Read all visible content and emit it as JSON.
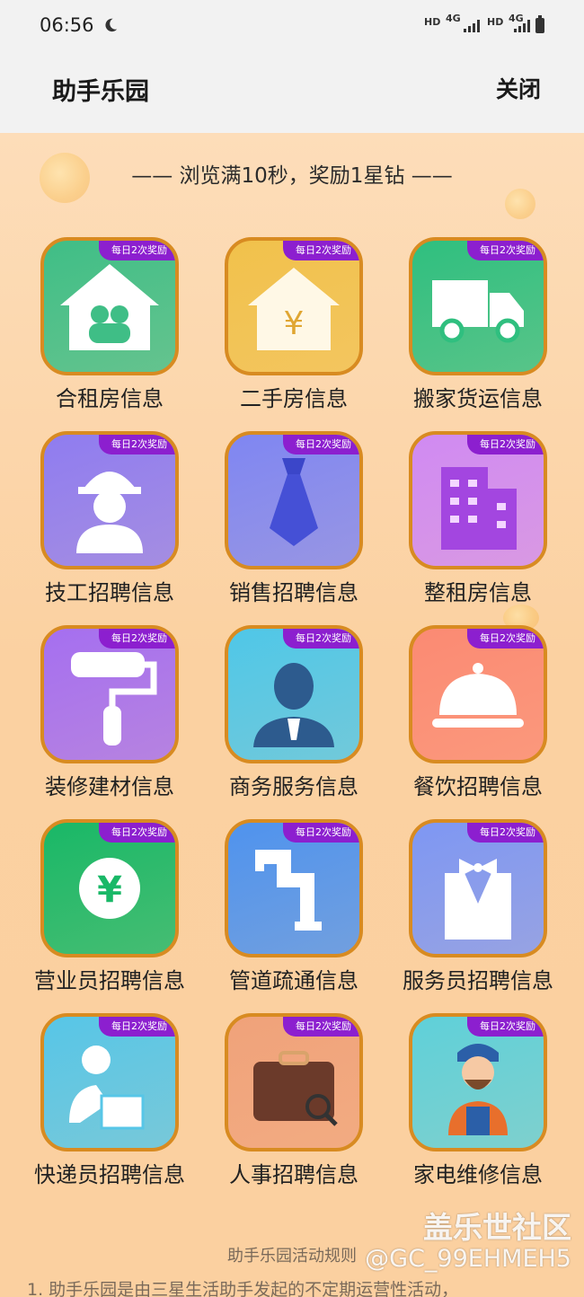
{
  "status_bar": {
    "time": "06:56",
    "net_hd1": "HD",
    "net_4g1": "4G",
    "net_hd2": "HD",
    "net_4g2": "4G"
  },
  "header": {
    "title": "助手乐园",
    "close_label": "关闭"
  },
  "banner": "—— 浏览满10秒，奖励1星钻 ——",
  "tiles": [
    {
      "label": "合租房信息",
      "badge": "每日2次奖励",
      "icon": "shared-house-icon",
      "color": "#3fbe86"
    },
    {
      "label": "二手房信息",
      "badge": "每日2次奖励",
      "icon": "house-yuan-icon",
      "color": "#f1c14b"
    },
    {
      "label": "搬家货运信息",
      "badge": "每日2次奖励",
      "icon": "truck-icon",
      "color": "#2fbf7f"
    },
    {
      "label": "技工招聘信息",
      "badge": "每日2次奖励",
      "icon": "hard-hat-worker-icon",
      "color": "#8f7cf0"
    },
    {
      "label": "销售招聘信息",
      "badge": "每日2次奖励",
      "icon": "necktie-icon",
      "color": "#7f86f2"
    },
    {
      "label": "整租房信息",
      "badge": "每日2次奖励",
      "icon": "building-icon",
      "color": "#d08af2"
    },
    {
      "label": "装修建材信息",
      "badge": "每日2次奖励",
      "icon": "paint-roller-icon",
      "color": "#a56ff0"
    },
    {
      "label": "商务服务信息",
      "badge": "每日2次奖励",
      "icon": "business-person-icon",
      "color": "#4fc7e8"
    },
    {
      "label": "餐饮招聘信息",
      "badge": "每日2次奖励",
      "icon": "food-cloche-icon",
      "color": "#fb8a73"
    },
    {
      "label": "营业员招聘信息",
      "badge": "每日2次奖励",
      "icon": "yuan-coin-icon",
      "color": "#19b867"
    },
    {
      "label": "管道疏通信息",
      "badge": "每日2次奖励",
      "icon": "pipe-icon",
      "color": "#4f93ee"
    },
    {
      "label": "服务员招聘信息",
      "badge": "每日2次奖励",
      "icon": "waiter-bowtie-icon",
      "color": "#7e97f3"
    },
    {
      "label": "快递员招聘信息",
      "badge": "每日2次奖励",
      "icon": "courier-package-icon",
      "color": "#57c6e7"
    },
    {
      "label": "人事招聘信息",
      "badge": "每日2次奖励",
      "icon": "briefcase-icon",
      "color": "#f0a27a"
    },
    {
      "label": "家电维修信息",
      "badge": "每日2次奖励",
      "icon": "repairman-icon",
      "color": "#5fd0d9"
    }
  ],
  "rules": {
    "title": "助手乐园活动规则",
    "line1": "1. 助手乐园是由三星生活助手发起的不定期运营性活动，"
  },
  "watermark": {
    "line1": "盖乐世社区",
    "line2": "@GC_99EHMEH5"
  }
}
